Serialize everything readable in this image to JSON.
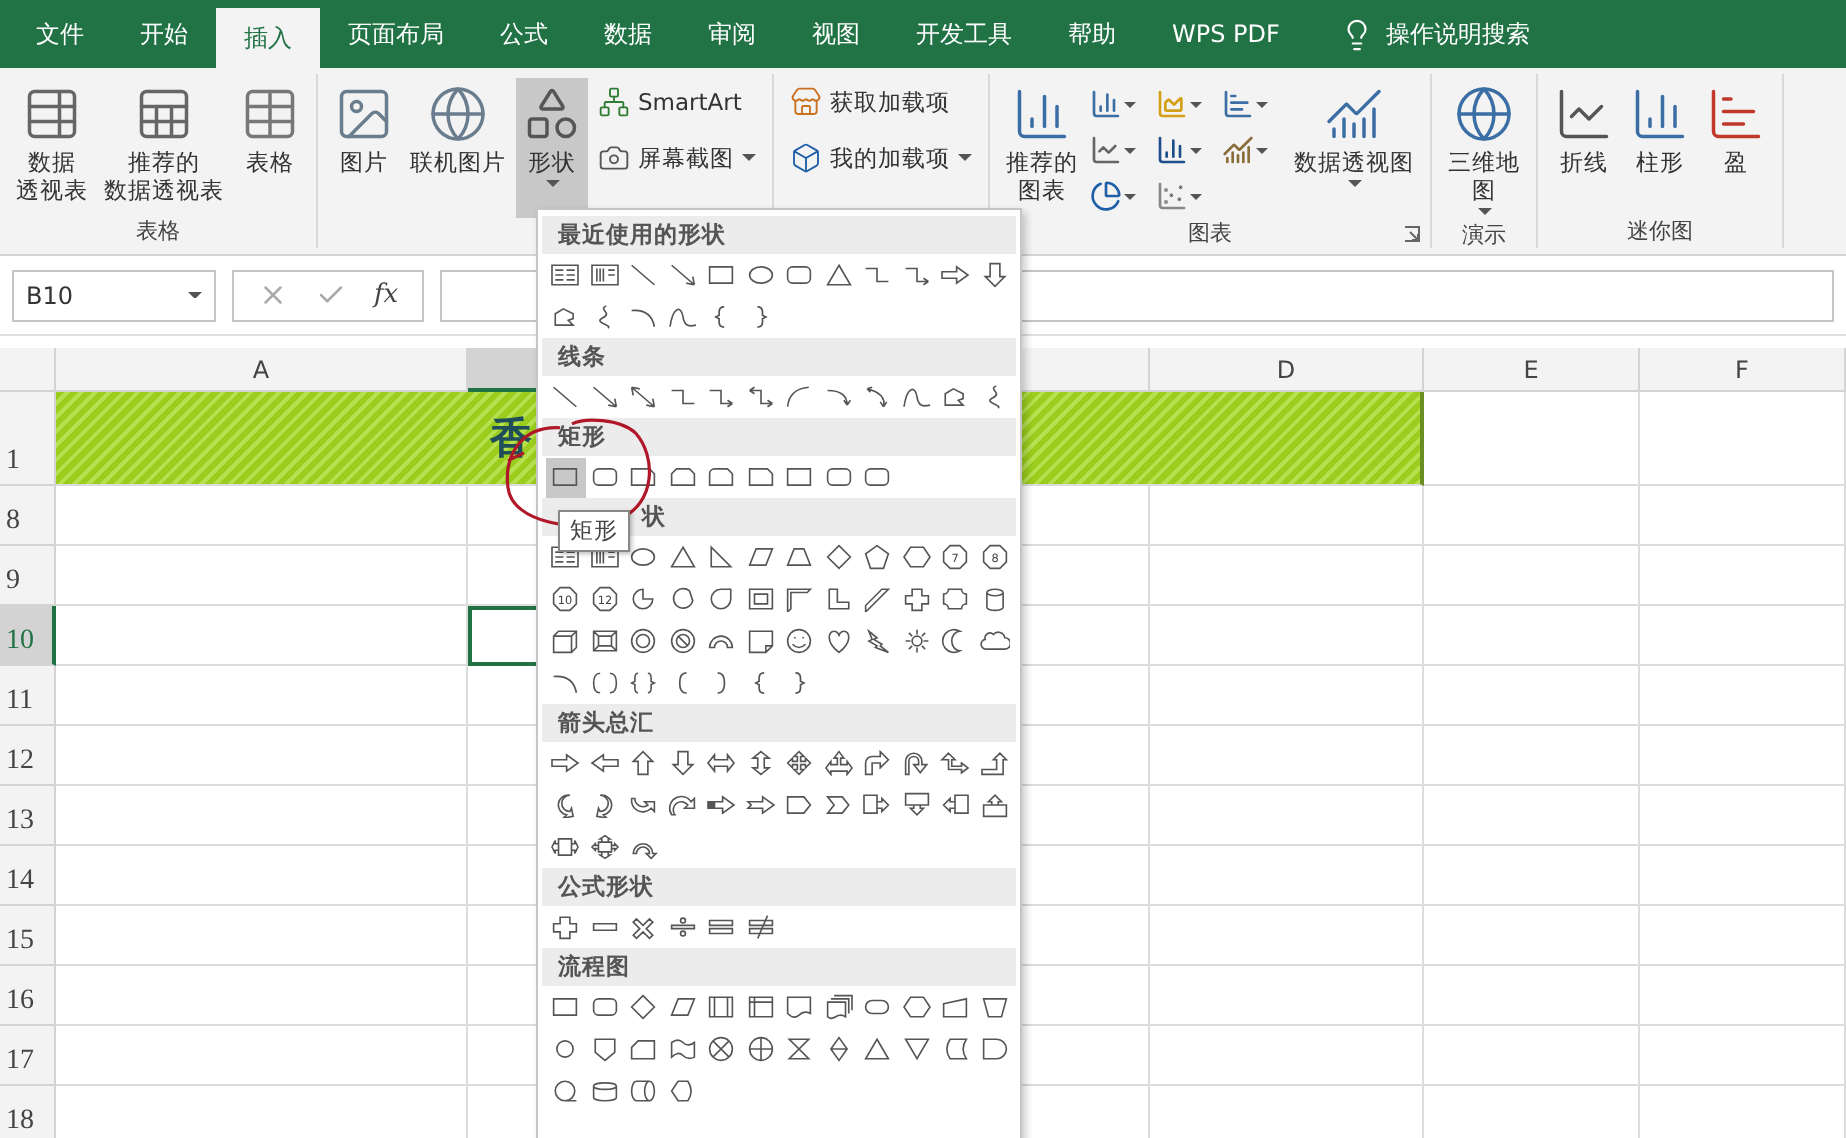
{
  "tabs": [
    {
      "label": "文件",
      "selected": false
    },
    {
      "label": "开始",
      "selected": false
    },
    {
      "label": "插入",
      "selected": true
    },
    {
      "label": "页面布局",
      "selected": false
    },
    {
      "label": "公式",
      "selected": false
    },
    {
      "label": "数据",
      "selected": false
    },
    {
      "label": "审阅",
      "selected": false
    },
    {
      "label": "视图",
      "selected": false
    },
    {
      "label": "开发工具",
      "selected": false
    },
    {
      "label": "帮助",
      "selected": false
    },
    {
      "label": "WPS PDF",
      "selected": false
    }
  ],
  "search": {
    "label": "操作说明搜索"
  },
  "ribbon": [
    {
      "label": "表格",
      "buttons": [
        {
          "kind": "large",
          "label": [
            "数据",
            "透视表"
          ],
          "pressed": false
        },
        {
          "kind": "large",
          "label": [
            "推荐的",
            "数据透视表"
          ],
          "pressed": false
        },
        {
          "kind": "large",
          "label": [
            "表格"
          ],
          "pressed": false
        }
      ]
    },
    {
      "buttons": [
        {
          "kind": "large",
          "label": [
            "图片"
          ],
          "pressed": false
        },
        {
          "kind": "large",
          "label": [
            "联机图片"
          ],
          "pressed": false
        },
        {
          "kind": "large",
          "label": [
            "形状"
          ],
          "pressed": true,
          "dropdown": true
        },
        {
          "kind": "small",
          "label": [
            "SmartArt"
          ],
          "pressed": false
        },
        {
          "kind": "small",
          "label": [
            "屏幕截图"
          ],
          "pressed": false,
          "dropdown": true
        }
      ]
    },
    {
      "buttons": [
        {
          "kind": "small",
          "label": [
            "获取加载项"
          ],
          "pressed": false
        },
        {
          "kind": "small",
          "label": [
            "我的加载项"
          ],
          "pressed": false,
          "dropdown": true
        }
      ]
    },
    {
      "label": "图表",
      "launcher": true,
      "buttons": [
        {
          "kind": "large",
          "label": [
            "推荐的",
            "图表"
          ],
          "pressed": false
        },
        {
          "kind": "chart-grid"
        },
        {
          "kind": "large",
          "label": [
            "数据透视图"
          ],
          "pressed": false,
          "dropdown": true
        }
      ]
    },
    {
      "label": "演示",
      "buttons": [
        {
          "kind": "large",
          "label": [
            "三维地",
            "图"
          ],
          "pressed": false,
          "dropdown": true
        }
      ]
    },
    {
      "label": "迷你图",
      "buttons": [
        {
          "kind": "large",
          "label": [
            "折线"
          ],
          "pressed": false
        },
        {
          "kind": "large",
          "label": [
            "柱形"
          ],
          "pressed": false
        },
        {
          "kind": "large",
          "label": [
            "盈"
          ],
          "pressed": false
        }
      ]
    }
  ],
  "formula_bar": {
    "name_box": "B10",
    "function_label": "fx"
  },
  "columns": [
    {
      "label": "A",
      "selected": false
    },
    {
      "selected": true
    },
    {
      "selected": false
    },
    {
      "label": "D",
      "selected": false
    },
    {
      "label": "E",
      "selected": false
    },
    {
      "label": "F",
      "selected": false
    }
  ],
  "rows": [
    {
      "label": "1",
      "selected": false,
      "title": "香"
    },
    {
      "label": "8",
      "selected": false
    },
    {
      "label": "9",
      "selected": false
    },
    {
      "label": "10",
      "selected": true
    },
    {
      "label": "11",
      "selected": false
    },
    {
      "label": "12",
      "selected": false
    },
    {
      "label": "13",
      "selected": false
    },
    {
      "label": "14",
      "selected": false
    },
    {
      "label": "15",
      "selected": false
    },
    {
      "label": "16",
      "selected": false
    },
    {
      "label": "17",
      "selected": false
    },
    {
      "label": "18",
      "selected": false
    }
  ],
  "shapes_menu": {
    "sections": [
      {
        "title": "最近使用的形状",
        "rows": [
          [
            {
              "kind": "textbox"
            },
            {
              "kind": "vtextbox"
            },
            {
              "kind": "line"
            },
            {
              "kind": "arrowline"
            },
            {
              "kind": "rect"
            },
            {
              "kind": "oval"
            },
            {
              "kind": "rounded"
            },
            {
              "kind": "triangle"
            },
            {
              "kind": "elbow"
            },
            {
              "kind": "elbowarrow"
            },
            {
              "kind": "arrow-r"
            },
            {
              "kind": "arrow-d"
            }
          ],
          [
            {
              "kind": "freeform"
            },
            {
              "kind": "scribble"
            },
            {
              "kind": "arc"
            },
            {
              "kind": "wave"
            },
            {
              "kind": "brace-l"
            },
            {
              "kind": "brace-r"
            }
          ]
        ]
      },
      {
        "title": "线条",
        "rows": [
          [
            {
              "kind": "line"
            },
            {
              "kind": "arrowline"
            },
            {
              "kind": "dblarrow"
            },
            {
              "kind": "elbow"
            },
            {
              "kind": "elbowarrow"
            },
            {
              "kind": "elbowdbl"
            },
            {
              "kind": "curve"
            },
            {
              "kind": "curvearrow"
            },
            {
              "kind": "curvedbl"
            },
            {
              "kind": "wave"
            },
            {
              "kind": "freeform"
            },
            {
              "kind": "scribble"
            }
          ]
        ]
      },
      {
        "title": "矩形",
        "rows": [
          [
            {
              "kind": "rect",
              "selected": true
            },
            {
              "kind": "rounded",
              "selected": false
            },
            {
              "kind": "snip",
              "selected": false
            },
            {
              "kind": "snip2",
              "selected": false
            },
            {
              "kind": "snipround",
              "selected": false
            },
            {
              "kind": "snip",
              "selected": false
            },
            {
              "kind": "rect",
              "selected": false
            },
            {
              "kind": "rounded",
              "selected": false
            },
            {
              "kind": "rounded",
              "selected": false
            }
          ]
        ]
      },
      {
        "title": "状",
        "tooltip": "矩形",
        "rows": [
          [
            {
              "kind": "textbox"
            },
            {
              "kind": "vtextbox"
            },
            {
              "kind": "oval"
            },
            {
              "kind": "triangle"
            },
            {
              "kind": "rtriangle"
            },
            {
              "kind": "parallelogram"
            },
            {
              "kind": "trapezoid"
            },
            {
              "kind": "diamond"
            },
            {
              "kind": "pentagon"
            },
            {
              "kind": "hexagon"
            },
            {
              "kind": "octagon",
              "label": "7"
            },
            {
              "kind": "octagon",
              "label": "8"
            }
          ],
          [
            {
              "kind": "octagon",
              "label": "10"
            },
            {
              "kind": "octagon",
              "label": "12"
            },
            {
              "kind": "pie"
            },
            {
              "kind": "chord"
            },
            {
              "kind": "teardrop"
            },
            {
              "kind": "frame"
            },
            {
              "kind": "halfframe"
            },
            {
              "kind": "lshape"
            },
            {
              "kind": "diagstripe"
            },
            {
              "kind": "cross"
            },
            {
              "kind": "plaque"
            },
            {
              "kind": "cylinder"
            }
          ],
          [
            {
              "kind": "cube"
            },
            {
              "kind": "bevel"
            },
            {
              "kind": "donut"
            },
            {
              "kind": "nosign"
            },
            {
              "kind": "blockarc"
            },
            {
              "kind": "fold"
            },
            {
              "kind": "smiley"
            },
            {
              "kind": "heart"
            },
            {
              "kind": "bolt"
            },
            {
              "kind": "sun"
            },
            {
              "kind": "moon"
            },
            {
              "kind": "cloud"
            }
          ],
          [
            {
              "kind": "arc"
            },
            {
              "kind": "bracketpair"
            },
            {
              "kind": "bracepair"
            },
            {
              "kind": "bracket-l"
            },
            {
              "kind": "bracket-r"
            },
            {
              "kind": "brace-l"
            },
            {
              "kind": "brace-r"
            }
          ]
        ]
      },
      {
        "title": "箭头总汇",
        "rows": [
          [
            {
              "kind": "arrow-r"
            },
            {
              "kind": "arrow-l"
            },
            {
              "kind": "arrow-u"
            },
            {
              "kind": "arrow-d"
            },
            {
              "kind": "arrow-lr"
            },
            {
              "kind": "arrow-ud"
            },
            {
              "kind": "arrow-quad"
            },
            {
              "kind": "arrow-lru"
            },
            {
              "kind": "bentarrow"
            },
            {
              "kind": "uturn"
            },
            {
              "kind": "arrow-lu"
            },
            {
              "kind": "bentup"
            }
          ],
          [
            {
              "kind": "curved-r"
            },
            {
              "kind": "curved-l"
            },
            {
              "kind": "curved-u"
            },
            {
              "kind": "curved-d"
            },
            {
              "kind": "striped-r"
            },
            {
              "kind": "notched-r"
            },
            {
              "kind": "pentagon-arrow"
            },
            {
              "kind": "chevron"
            },
            {
              "kind": "callout-r"
            },
            {
              "kind": "callout-d"
            },
            {
              "kind": "callout-l"
            },
            {
              "kind": "callout-u"
            }
          ],
          [
            {
              "kind": "callout-lr"
            },
            {
              "kind": "callout-quad"
            },
            {
              "kind": "circular"
            }
          ]
        ]
      },
      {
        "title": "公式形状",
        "rows": [
          [
            {
              "kind": "cross"
            },
            {
              "kind": "minus"
            },
            {
              "kind": "multiply"
            },
            {
              "kind": "divide"
            },
            {
              "kind": "equal"
            },
            {
              "kind": "notequal"
            }
          ]
        ]
      },
      {
        "title": "流程图",
        "rows": [
          [
            {
              "kind": "rect"
            },
            {
              "kind": "rounded"
            },
            {
              "kind": "diamond"
            },
            {
              "kind": "parallelogram"
            },
            {
              "kind": "predefined"
            },
            {
              "kind": "internal"
            },
            {
              "kind": "document"
            },
            {
              "kind": "multidoc"
            },
            {
              "kind": "terminator"
            },
            {
              "kind": "hexagon"
            },
            {
              "kind": "manual-input"
            },
            {
              "kind": "manual-op"
            }
          ],
          [
            {
              "kind": "connector"
            },
            {
              "kind": "offpage"
            },
            {
              "kind": "card"
            },
            {
              "kind": "tape"
            },
            {
              "kind": "summing"
            },
            {
              "kind": "or"
            },
            {
              "kind": "collate"
            },
            {
              "kind": "sort"
            },
            {
              "kind": "extract"
            },
            {
              "kind": "merge"
            },
            {
              "kind": "stored"
            },
            {
              "kind": "delay"
            }
          ],
          [
            {
              "kind": "seqaccess"
            },
            {
              "kind": "disk"
            },
            {
              "kind": "directaccess"
            },
            {
              "kind": "display"
            }
          ]
        ]
      }
    ]
  }
}
